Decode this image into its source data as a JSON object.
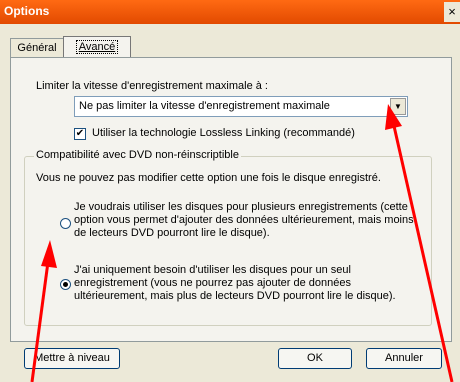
{
  "window": {
    "title": "Options",
    "close_label": "×"
  },
  "tabs": [
    {
      "label": "Général"
    },
    {
      "label": "Avancé"
    }
  ],
  "speed": {
    "label": "Limiter la vitesse d'enregistrement maximale à :",
    "selected": "Ne pas limiter la vitesse d'enregistrement maximale"
  },
  "lossless": {
    "label": "Utiliser la technologie Lossless Linking (recommandé)",
    "checked": true
  },
  "compat": {
    "title": "Compatibilité avec DVD non-réinscriptible",
    "note": "Vous ne pouvez pas modifier cette option une fois le disque enregistré.",
    "options": [
      {
        "text": "Je voudrais utiliser les disques pour plusieurs enregistrements (cette option vous permet d'ajouter des données ultérieurement, mais moins de lecteurs DVD pourront lire le disque).",
        "selected": false
      },
      {
        "text": "J'ai uniquement besoin d'utiliser les disques pour un seul enregistrement (vous ne pourrez pas ajouter de données ultérieurement, mais plus de lecteurs DVD pourront lire le disque).",
        "selected": true
      }
    ]
  },
  "buttons": {
    "upgrade": "Mettre à niveau",
    "ok": "OK",
    "cancel": "Annuler"
  },
  "colors": {
    "annotation_arrow": "#FF0000",
    "title_bar": "#FF6A13"
  }
}
